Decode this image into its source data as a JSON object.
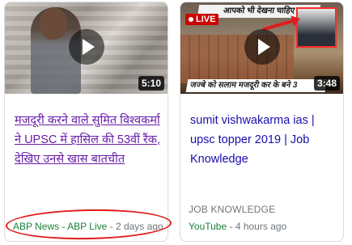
{
  "cards": [
    {
      "title": "मजदूरी करने वाले सुमित विश्वकर्मा ने UPSC में हासिल की 53वीं रैंक, देखिए उनसे खास बातचीत",
      "duration": "5:10",
      "source": "ABP News - ABP Live",
      "separator": " - ",
      "time": "2 days ago",
      "play_icon": "play-icon",
      "title_color": "#681da8"
    },
    {
      "title": "sumit vishwakarma ias | upsc topper 2019 | Job Knowledge",
      "duration": "3:48",
      "live_label": "LIVE",
      "thumb_headline": "आपको भी देखना चाहिए",
      "thumb_subtitle": "जज्बे को सलाम मजदूरी कर के बने 3",
      "channel": "JOB KNOWLEDGE",
      "source": "YouTube",
      "separator": " - ",
      "time": "4 hours ago",
      "play_icon": "play-icon",
      "title_color": "#1a0dab"
    }
  ],
  "colors": {
    "source_green": "#188038",
    "meta_gray": "#70757a",
    "annotation_red": "#e01b1b",
    "border": "#dadce0"
  }
}
